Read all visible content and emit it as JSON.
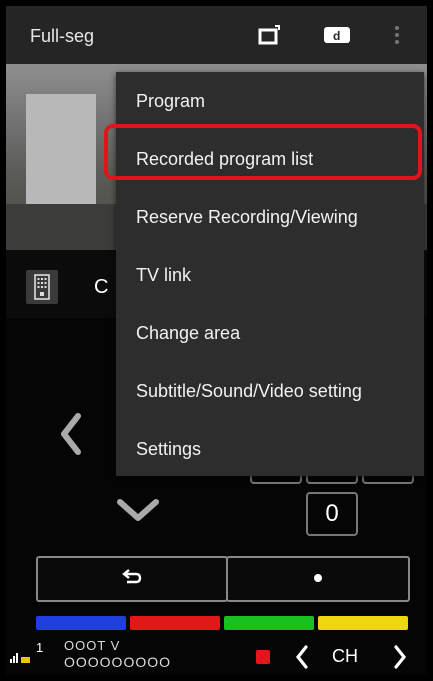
{
  "header": {
    "title": "Full-seg",
    "icons": [
      "popup-window-icon",
      "d-button-icon",
      "overflow-menu-icon"
    ]
  },
  "channel_row": {
    "remote_icon": "remote-control-icon",
    "channel_letter": "C"
  },
  "keypad": {
    "visible_key": "0"
  },
  "controls": {
    "back_icon": "return-arrow-icon",
    "center_icon": "dot-icon"
  },
  "color_keys": [
    {
      "name": "blue",
      "color": "#1e3ee0"
    },
    {
      "name": "red",
      "color": "#e21818"
    },
    {
      "name": "green",
      "color": "#18c11f"
    },
    {
      "name": "yellow",
      "color": "#ecd80c"
    }
  ],
  "footer": {
    "channel_number": "1",
    "station_name": "OOOT V",
    "program_name": "OOOOOOOOO",
    "ch_label": "CH"
  },
  "menu": {
    "items": [
      "Program",
      "Recorded program list",
      "Reserve Recording/Viewing",
      "TV link",
      "Change area",
      "Subtitle/Sound/Video setting",
      "Settings"
    ],
    "highlighted_item": "Recorded program list",
    "highlight_color": "#e1141c"
  }
}
